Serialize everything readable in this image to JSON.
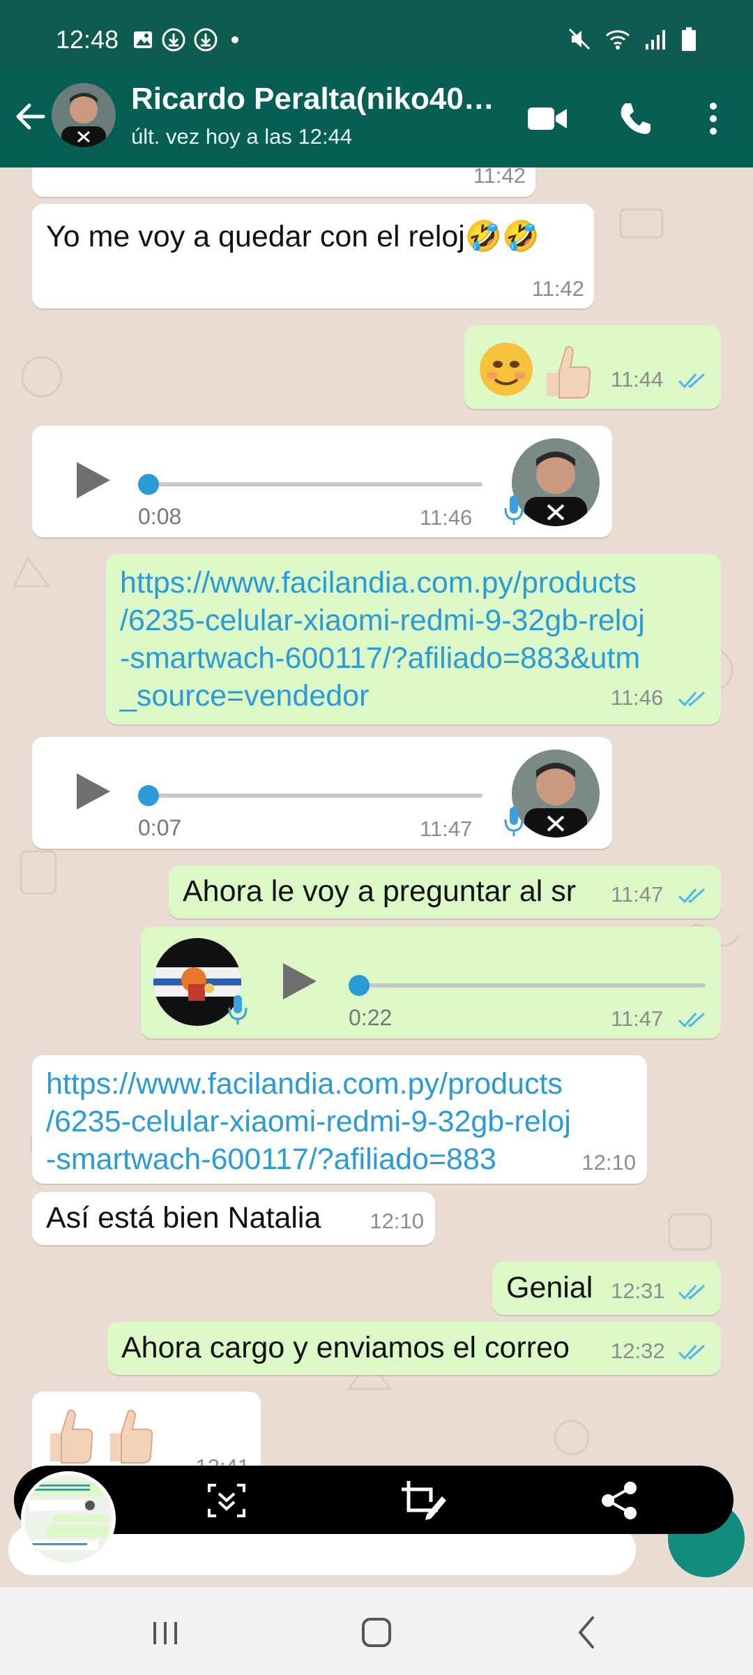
{
  "status_bar": {
    "time": "12:48",
    "left_icons": [
      "image-icon",
      "download-icon",
      "download-icon",
      "dot-icon"
    ],
    "right_icons": [
      "mute-icon",
      "wifi-icon",
      "signal-icon",
      "battery-icon"
    ]
  },
  "header": {
    "contact_name": "Ricardo Peralta(niko40…",
    "contact_status": "últ. vez hoy a las 12:44",
    "icons": [
      "back-arrow-icon",
      "video-call-icon",
      "phone-icon",
      "more-vert-icon"
    ]
  },
  "colors": {
    "header_bg": "#075e54",
    "status_bg": "#0d5c4f",
    "chat_bg": "#e9ddd3",
    "incoming_bubble": "#ffffff",
    "outgoing_bubble": "#dcf8c6",
    "link": "#2a9bd6",
    "read_ticks": "#4fb6ec"
  },
  "messages": [
    {
      "dir": "in",
      "type": "text",
      "text": "",
      "time": "11:42"
    },
    {
      "dir": "in",
      "type": "text",
      "text": "Yo me voy a quedar con el reloj🤣🤣",
      "time": "11:42"
    },
    {
      "dir": "out",
      "type": "emoji",
      "text": "😊👍🏻",
      "time": "11:44",
      "status": "read"
    },
    {
      "dir": "in",
      "type": "audio",
      "duration": "0:08",
      "time": "11:46"
    },
    {
      "dir": "out",
      "type": "link",
      "lines": [
        "https://www.facilandia.com.py/products",
        "/6235-celular-xiaomi-redmi-9-32gb-reloj",
        "-smartwach-600117/?afiliado=883&utm",
        "_source=vendedor"
      ],
      "time": "11:46",
      "status": "read"
    },
    {
      "dir": "in",
      "type": "audio",
      "duration": "0:07",
      "time": "11:47"
    },
    {
      "dir": "out",
      "type": "text",
      "text": "Ahora le voy a preguntar al sr",
      "time": "11:47",
      "status": "read"
    },
    {
      "dir": "out",
      "type": "audio",
      "duration": "0:22",
      "time": "11:47",
      "status": "read"
    },
    {
      "dir": "in",
      "type": "link",
      "lines": [
        "https://www.facilandia.com.py/products",
        "/6235-celular-xiaomi-redmi-9-32gb-reloj",
        "-smartwach-600117/?afiliado=883"
      ],
      "time": "12:10"
    },
    {
      "dir": "in",
      "type": "text",
      "text": "Así está bien Natalia",
      "time": "12:10"
    },
    {
      "dir": "out",
      "type": "text",
      "text": "Genial",
      "time": "12:31",
      "status": "read"
    },
    {
      "dir": "out",
      "type": "text",
      "text": "Ahora cargo y enviamos el correo",
      "time": "12:32",
      "status": "read"
    },
    {
      "dir": "in",
      "type": "emoji",
      "text": "👍🏻👍🏻",
      "time": "12:41"
    }
  ],
  "screenshot_toolbar": {
    "icons": [
      "scroll-capture-icon",
      "crop-edit-icon",
      "share-icon"
    ]
  },
  "nav_bar": {
    "icons": [
      "recent-apps-icon",
      "home-icon",
      "back-icon"
    ]
  }
}
